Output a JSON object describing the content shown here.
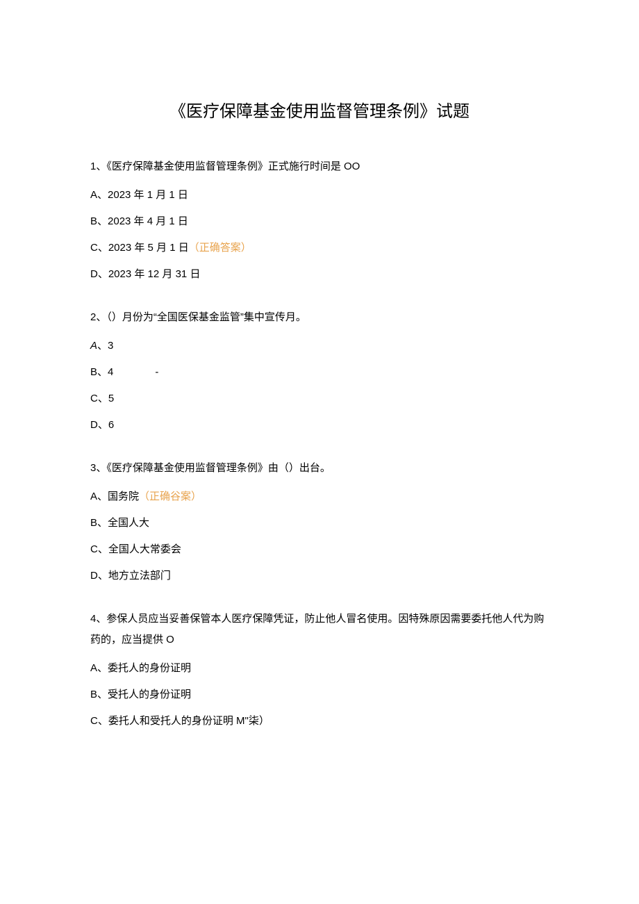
{
  "title": "《医疗保障基金使用监督管理条例》试题",
  "questions": [
    {
      "text": "1、《医疗保障基金使用监督管理条例》正式施行时间是 OO",
      "options": [
        {
          "label": "A、2023 ",
          "chinese": "年 ",
          "suffix": "1 ",
          "month": "月 ",
          "day": "1 ",
          "dayunit": "日",
          "correct": false
        },
        {
          "label": "B、2023 ",
          "chinese": "年 ",
          "suffix": "4 ",
          "month": "月 ",
          "day": "1 ",
          "dayunit": "日",
          "correct": false
        },
        {
          "label": "C、2023 ",
          "chinese": "年 ",
          "suffix": "5 ",
          "month": "月 ",
          "day": "1 ",
          "dayunit": "日",
          "correct": true,
          "correctText": "（正确答案）"
        },
        {
          "label": "D、2023 ",
          "chinese": "年 ",
          "suffix": "12 ",
          "month": "月 ",
          "day": "31 ",
          "dayunit": "日",
          "correct": false
        }
      ]
    },
    {
      "text": "2、（）月份为“全国医保基金监管”集中宣传月。",
      "options": [
        {
          "label": "A",
          "chinese": "、3",
          "italic": true
        },
        {
          "label": "B、4",
          "dash": "-"
        },
        {
          "label": "C、5"
        },
        {
          "label": "D、6"
        }
      ]
    },
    {
      "text": "3、《医疗保障基金使用监督管理条例》由（）出台。",
      "options": [
        {
          "label": "A、国务院",
          "correct": true,
          "correctText": "（正确谷案）"
        },
        {
          "label": "B、全国人大"
        },
        {
          "label": "C、全国人大常委会"
        },
        {
          "label": "D、地方立法部门"
        }
      ]
    },
    {
      "text": "4、参保人员应当妥善保管本人医疗保障凭证，防止他人冒名使用。因特殊原因需要委托他人代为购药的，应当提供 O",
      "options": [
        {
          "label": "A、委托人的身份证明"
        },
        {
          "label": "B、受托人的身份证明"
        },
        {
          "label": "C、委托人和受托人的身份证明 M\"柒）"
        }
      ]
    }
  ]
}
